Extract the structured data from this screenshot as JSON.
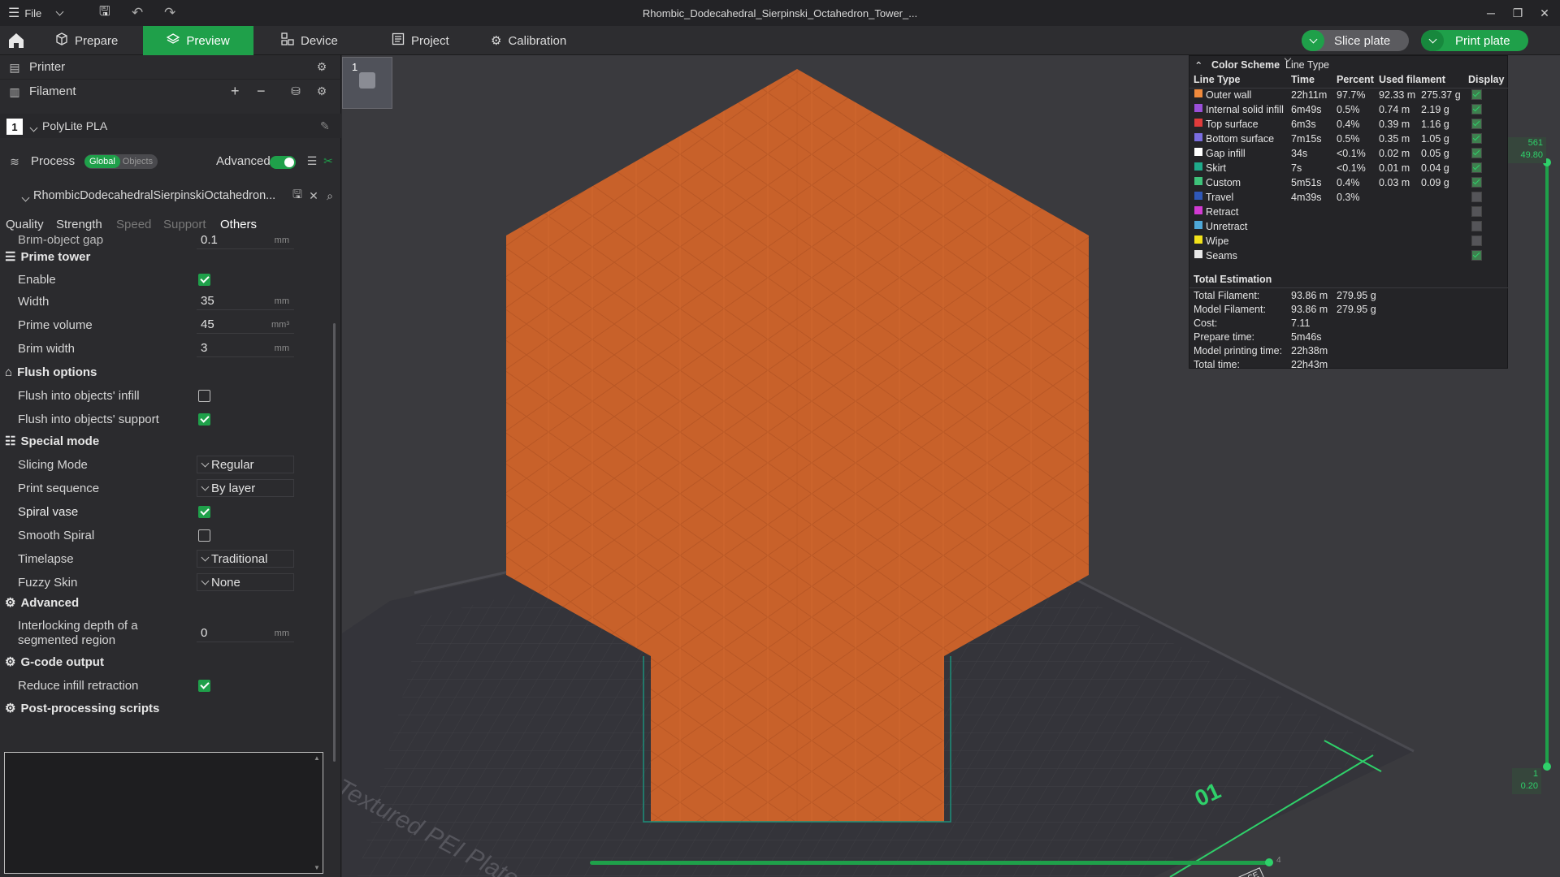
{
  "app": {
    "window_title": "Rhombic_Dodecahedral_Sierpinski_Octahedron_Tower_...",
    "file_menu": "File",
    "accent": "#1fa04a"
  },
  "tabs": [
    {
      "label": "Prepare",
      "icon": "cube-icon"
    },
    {
      "label": "Preview",
      "icon": "layers-icon"
    },
    {
      "label": "Device",
      "icon": "device-icon"
    },
    {
      "label": "Project",
      "icon": "project-icon"
    },
    {
      "label": "Calibration",
      "icon": "calibration-icon"
    }
  ],
  "actions": {
    "slice": "Slice plate",
    "print": "Print plate"
  },
  "left": {
    "printer_label": "Printer",
    "filament_label": "Filament",
    "filament_slot": "1",
    "filament_name": "PolyLite PLA",
    "process_label": "Process",
    "global_label": "Global",
    "objects_label": "Objects",
    "advanced_label": "Advanced",
    "object_name": "RhombicDodecahedralSierpinskiOctahedron...",
    "tabs": [
      "Quality",
      "Strength",
      "Speed",
      "Support",
      "Others"
    ],
    "brim_gap": {
      "label": "Brim-object gap",
      "value": "0.1",
      "unit": "mm"
    },
    "prime_tower": {
      "title": "Prime tower",
      "enable_label": "Enable",
      "width_label": "Width",
      "width_value": "35",
      "width_unit": "mm",
      "volume_label": "Prime volume",
      "volume_value": "45",
      "volume_unit": "mm³",
      "brim_label": "Brim width",
      "brim_value": "3",
      "brim_unit": "mm"
    },
    "flush": {
      "title": "Flush options",
      "infill_label": "Flush into objects' infill",
      "support_label": "Flush into objects' support"
    },
    "special": {
      "title": "Special mode",
      "slicing_label": "Slicing Mode",
      "slicing_value": "Regular",
      "sequence_label": "Print sequence",
      "sequence_value": "By layer",
      "spiral_label": "Spiral vase",
      "smooth_label": "Smooth Spiral",
      "timelapse_label": "Timelapse",
      "timelapse_value": "Traditional",
      "fuzzy_label": "Fuzzy Skin",
      "fuzzy_value": "None"
    },
    "advanced": {
      "title": "Advanced",
      "interlock_label_1": "Interlocking depth of a",
      "interlock_label_2": "segmented region",
      "interlock_value": "0",
      "interlock_unit": "mm"
    },
    "gcode": {
      "title": "G-code output",
      "reduce_label": "Reduce infill retraction"
    },
    "post": {
      "title": "Post-processing scripts"
    }
  },
  "viewport": {
    "plate_number": "1",
    "plate_text": "Textured PEI Plate",
    "hot_surface": "HOT SURFACE",
    "bed_number": "01",
    "slider_top_1": "561",
    "slider_top_2": "49.80",
    "slider_bottom_1": "1",
    "slider_bottom_2": "0.20",
    "horizontal_slider_value": "4",
    "model_color": "#c8612a"
  },
  "legend": {
    "color_scheme_label": "Color Scheme",
    "scheme_value": "Line Type",
    "headers": [
      "Line Type",
      "Time",
      "Percent",
      "Used filament",
      "Display"
    ],
    "rows": [
      {
        "name": "Outer wall",
        "color": "#f08a3c",
        "time": "22h11m",
        "percent": "97.7%",
        "m": "92.33 m",
        "g": "275.37 g",
        "on": true
      },
      {
        "name": "Internal solid infill",
        "color": "#9a4fd8",
        "time": "6m49s",
        "percent": "0.5%",
        "m": "0.74 m",
        "g": "2.19 g",
        "on": true
      },
      {
        "name": "Top surface",
        "color": "#e03b3b",
        "time": "6m3s",
        "percent": "0.4%",
        "m": "0.39 m",
        "g": "1.16 g",
        "on": true
      },
      {
        "name": "Bottom surface",
        "color": "#7a6de0",
        "time": "7m15s",
        "percent": "0.5%",
        "m": "0.35 m",
        "g": "1.05 g",
        "on": true
      },
      {
        "name": "Gap infill",
        "color": "#ffffff",
        "time": "34s",
        "percent": "<0.1%",
        "m": "0.02 m",
        "g": "0.05 g",
        "on": true
      },
      {
        "name": "Skirt",
        "color": "#1faa8a",
        "time": "7s",
        "percent": "<0.1%",
        "m": "0.01 m",
        "g": "0.04 g",
        "on": true
      },
      {
        "name": "Custom",
        "color": "#3ec27a",
        "time": "5m51s",
        "percent": "0.4%",
        "m": "0.03 m",
        "g": "0.09 g",
        "on": true
      },
      {
        "name": "Travel",
        "color": "#2f58b8",
        "time": "4m39s",
        "percent": "0.3%",
        "m": "",
        "g": "",
        "on": false
      },
      {
        "name": "Retract",
        "color": "#d23ad2",
        "time": "",
        "percent": "",
        "m": "",
        "g": "",
        "on": false
      },
      {
        "name": "Unretract",
        "color": "#4ea8d8",
        "time": "",
        "percent": "",
        "m": "",
        "g": "",
        "on": false
      },
      {
        "name": "Wipe",
        "color": "#f2e21a",
        "time": "",
        "percent": "",
        "m": "",
        "g": "",
        "on": false
      },
      {
        "name": "Seams",
        "color": "#e8e8e8",
        "time": "",
        "percent": "",
        "m": "",
        "g": "",
        "on": true
      }
    ],
    "total_title": "Total Estimation",
    "totals": [
      {
        "label": "Total Filament:",
        "v1": "93.86 m",
        "v2": "279.95 g"
      },
      {
        "label": "Model Filament:",
        "v1": "93.86 m",
        "v2": "279.95 g"
      },
      {
        "label": "Cost:",
        "v1": "7.11",
        "v2": ""
      },
      {
        "label": "Prepare time:",
        "v1": "5m46s",
        "v2": ""
      },
      {
        "label": "Model printing time:",
        "v1": "22h38m",
        "v2": ""
      },
      {
        "label": "Total time:",
        "v1": "22h43m",
        "v2": ""
      }
    ]
  }
}
